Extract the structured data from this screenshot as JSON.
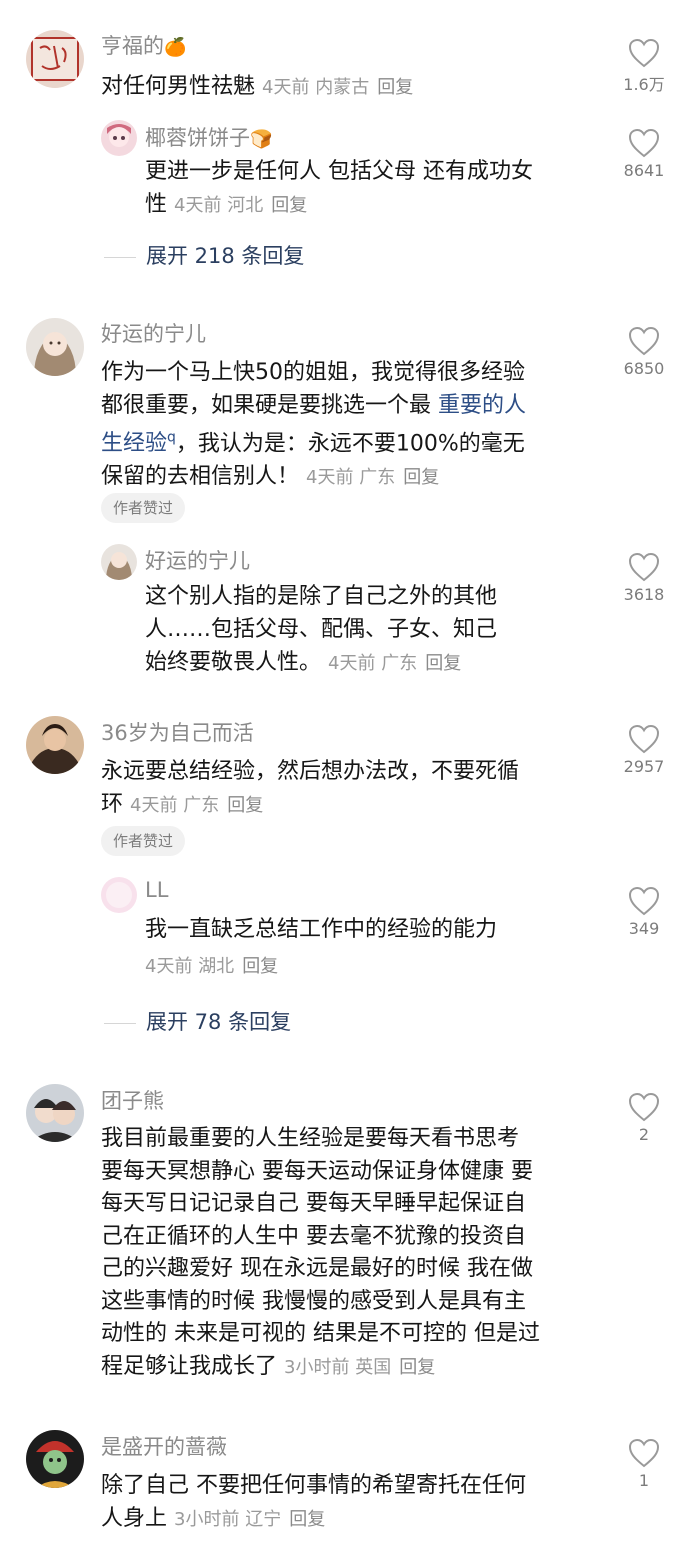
{
  "ui": {
    "reply_label": "回复",
    "author_liked_badge": "作者赞过",
    "colors": {
      "name": "#8a8a8a",
      "link": "#2d4e86",
      "meta": "#9a9a9a"
    }
  },
  "comments": [
    {
      "name": "亨福的",
      "name_emoji": "🍊",
      "text": "对任何男性祛魅",
      "time": "4天前",
      "location": "内蒙古",
      "likes": "1.6万",
      "replies": [
        {
          "name": "椰蓉饼饼子",
          "name_emoji": "🍞",
          "text_line1": "更进一步是任何人 包括父母 还有成功女",
          "text_line2": "性",
          "time": "4天前",
          "location": "河北",
          "likes": "8641"
        }
      ],
      "expand": "展开 218 条回复"
    },
    {
      "name": "好运的宁儿",
      "text_line1": "作为一个马上快50的姐姐，我觉得很多经验",
      "text_line2_a": "都很重要，如果硬是要挑选一个最 ",
      "link_a": "重要的人",
      "link_b": "生经验",
      "link_icon": "q",
      "text_line3_a": "，我认为是：永远不要100%的毫无",
      "text_line4": "保留的去相信别人！",
      "time": "4天前",
      "location": "广东",
      "likes": "6850",
      "badge": "作者赞过",
      "replies": [
        {
          "name": "好运的宁儿",
          "text_line1": "这个别人指的是除了自己之外的其他",
          "text_line2": "人……包括父母、配偶、子女、知己",
          "text_line3": "始终要敬畏人性。",
          "time": "4天前",
          "location": "广东",
          "likes": "3618"
        }
      ]
    },
    {
      "name": "36岁为自己而活",
      "text_line1": "永远要总结经验，然后想办法改，不要死循",
      "text_line2": "环",
      "time": "4天前",
      "location": "广东",
      "likes": "2957",
      "badge": "作者赞过",
      "replies": [
        {
          "name": "LL",
          "text_line1": "我一直缺乏总结工作中的经验的能力",
          "time": "4天前",
          "location": "湖北",
          "likes": "349"
        }
      ],
      "expand": "展开 78 条回复"
    },
    {
      "name": "团子熊",
      "lines": [
        "我目前最重要的人生经验是要每天看书思考",
        "要每天冥想静心 要每天运动保证身体健康 要",
        "每天写日记记录自己 要每天早睡早起保证自",
        "己在正循环的人生中 要去毫不犹豫的投资自",
        "己的兴趣爱好 现在永远是最好的时候 我在做",
        "这些事情的时候 我慢慢的感受到人是具有主",
        "动性的 未来是可视的 结果是不可控的 但是过",
        "程足够让我成长了"
      ],
      "time": "3小时前",
      "location": "英国",
      "likes": "2"
    },
    {
      "name": "是盛开的蔷薇",
      "text_line1": "除了自己 不要把任何事情的希望寄托在任何",
      "text_line2": "人身上",
      "time": "3小时前",
      "location": "辽宁",
      "likes": "1"
    }
  ]
}
